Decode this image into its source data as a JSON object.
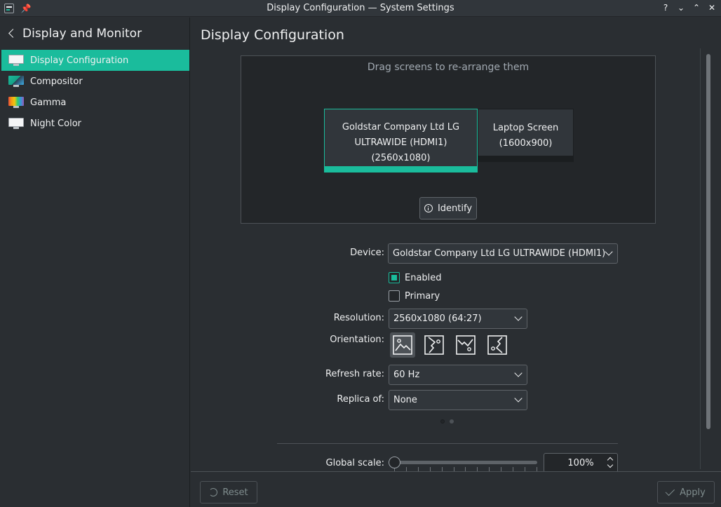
{
  "window": {
    "title": "Display Configuration — System Settings",
    "buttons": [
      "?",
      "⌄",
      "⌃",
      "✕"
    ]
  },
  "sidebar": {
    "back_title": "Display and Monitor",
    "items": [
      {
        "label": "Display Configuration",
        "icon": "display-icon",
        "active": true
      },
      {
        "label": "Compositor",
        "icon": "compositor-icon",
        "active": false
      },
      {
        "label": "Gamma",
        "icon": "gamma-icon",
        "active": false
      },
      {
        "label": "Night Color",
        "icon": "night-color-icon",
        "active": false
      }
    ]
  },
  "main": {
    "title": "Display Configuration",
    "arrange_hint": "Drag screens to re-arrange them",
    "screens": [
      {
        "line1": "Goldstar Company Ltd LG",
        "line2": "ULTRAWIDE (HDMI1)",
        "line3": "(2560x1080)",
        "primary": true
      },
      {
        "line1": "Laptop Screen",
        "line2": "(1600x900)",
        "primary": false
      }
    ],
    "identify_label": "Identify",
    "device": {
      "label": "Device:",
      "value": "Goldstar Company Ltd LG ULTRAWIDE (HDMI1)"
    },
    "enabled": {
      "label": "Enabled",
      "checked": true
    },
    "primary": {
      "label": "Primary",
      "checked": false
    },
    "resolution": {
      "label": "Resolution:",
      "value": "2560x1080 (64:27)"
    },
    "orientation": {
      "label": "Orientation:",
      "options": [
        "landscape",
        "portrait-right",
        "landscape-inverted",
        "portrait-left"
      ],
      "selected": 0
    },
    "refresh_rate": {
      "label": "Refresh rate:",
      "value": "60 Hz"
    },
    "replica": {
      "label": "Replica of:",
      "value": "None"
    },
    "global_scale": {
      "label": "Global scale:",
      "value": "100%",
      "level": 0
    }
  },
  "footer": {
    "reset_label": "Reset",
    "apply_label": "Apply"
  },
  "colors": {
    "accent": "#1abc9c",
    "background": "#2a2e32"
  }
}
